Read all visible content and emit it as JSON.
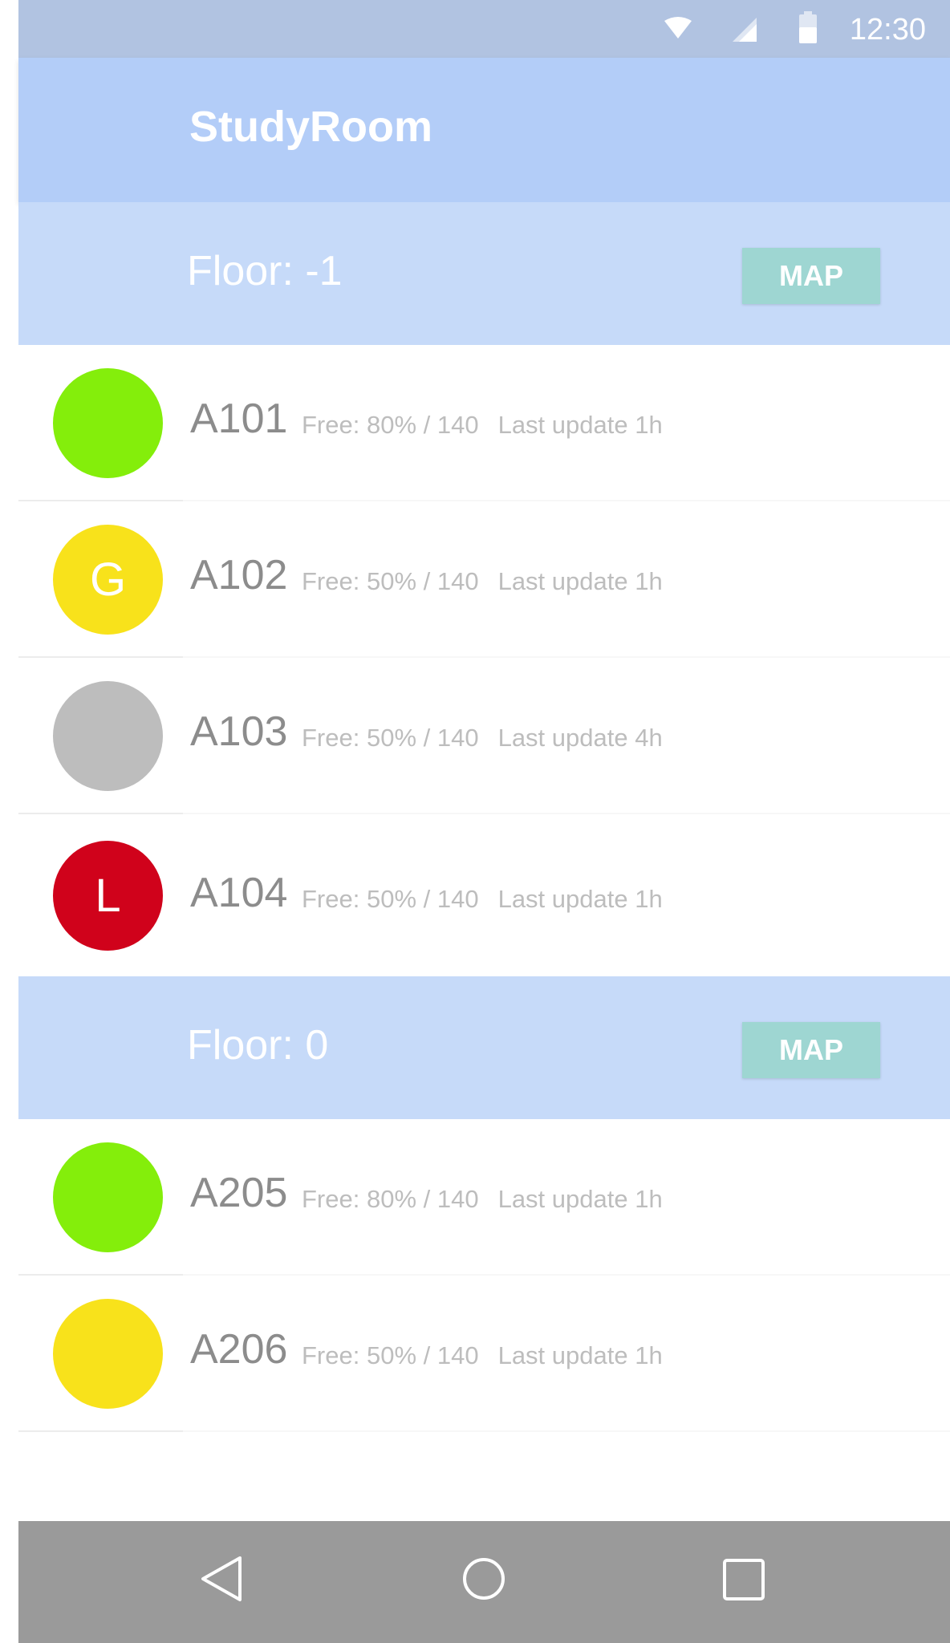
{
  "status_bar": {
    "time": "12:30",
    "icons": [
      "wifi-icon",
      "signal-icon",
      "battery-icon"
    ],
    "color": "#b1c3e1"
  },
  "app_bar": {
    "title": "StudyRoom",
    "color": "#b3cdf8"
  },
  "floors": [
    {
      "label": "Floor: -1",
      "map_label": "MAP",
      "rooms": [
        {
          "name": "A101",
          "free": "Free: 80% / 140",
          "update": "Last update 1h",
          "avatar_color": "#84ee0b",
          "avatar_letter": ""
        },
        {
          "name": "A102",
          "free": "Free: 50% / 140",
          "update": "Last update 1h",
          "avatar_color": "#f8e21b",
          "avatar_letter": "G"
        },
        {
          "name": "A103",
          "free": "Free: 50% / 140",
          "update": "Last update 4h",
          "avatar_color": "#bdbdbd",
          "avatar_letter": ""
        },
        {
          "name": "A104",
          "free": "Free: 50% / 140",
          "update": "Last update 1h",
          "avatar_color": "#d0021b",
          "avatar_letter": "L"
        }
      ]
    },
    {
      "label": "Floor: 0",
      "map_label": "MAP",
      "rooms": [
        {
          "name": "A205",
          "free": "Free: 80% / 140",
          "update": "Last update 1h",
          "avatar_color": "#84ee0b",
          "avatar_letter": ""
        },
        {
          "name": "A206",
          "free": "Free: 50% / 140",
          "update": "Last update 1h",
          "avatar_color": "#f8e21b",
          "avatar_letter": ""
        }
      ]
    }
  ],
  "nav_bar": {
    "icons": [
      "back-icon",
      "home-icon",
      "recents-icon"
    ],
    "color": "#9a9a9a"
  }
}
